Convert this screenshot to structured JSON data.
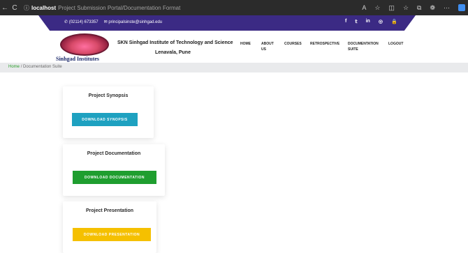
{
  "browser": {
    "back": "←",
    "refresh": "C",
    "host": "localhost",
    "page_title": "Project Submission Portal/Documentation Format"
  },
  "contact": {
    "phone": "(02114) 673357",
    "email": "principalsinste@sinhgad.edu"
  },
  "institute": {
    "logo_text": "Sinhgad Institutes",
    "name": "SKN Sinhgad Institute of Technology and Science",
    "location": "Lenavala, Pune"
  },
  "nav": {
    "home": "HOME",
    "about": "ABOUT US",
    "courses": "COURSES",
    "retrospective": "RETROSPECTIVE",
    "documentation": "DOCUMENTATION SUITE",
    "logout": "LOGOUT"
  },
  "breadcrumb": {
    "home": "Home",
    "separator": "/",
    "current": "Documentation Suite"
  },
  "cards": {
    "synopsis": {
      "title": "Project Synopsis",
      "button": "DOWNLOAD SYNOPSIS"
    },
    "documentation": {
      "title": "Project Documentation",
      "button": "DOWNLOAD DOCUMENTATION"
    },
    "presentation": {
      "title": "Project Presentation",
      "button": "DOWNLOAD PRESENTATION"
    }
  },
  "colors": {
    "top_strip": "#3b2a84",
    "synopsis_button": "#1ea1c0",
    "documentation_button": "#1f9e2f",
    "presentation_button": "#f5c000"
  }
}
